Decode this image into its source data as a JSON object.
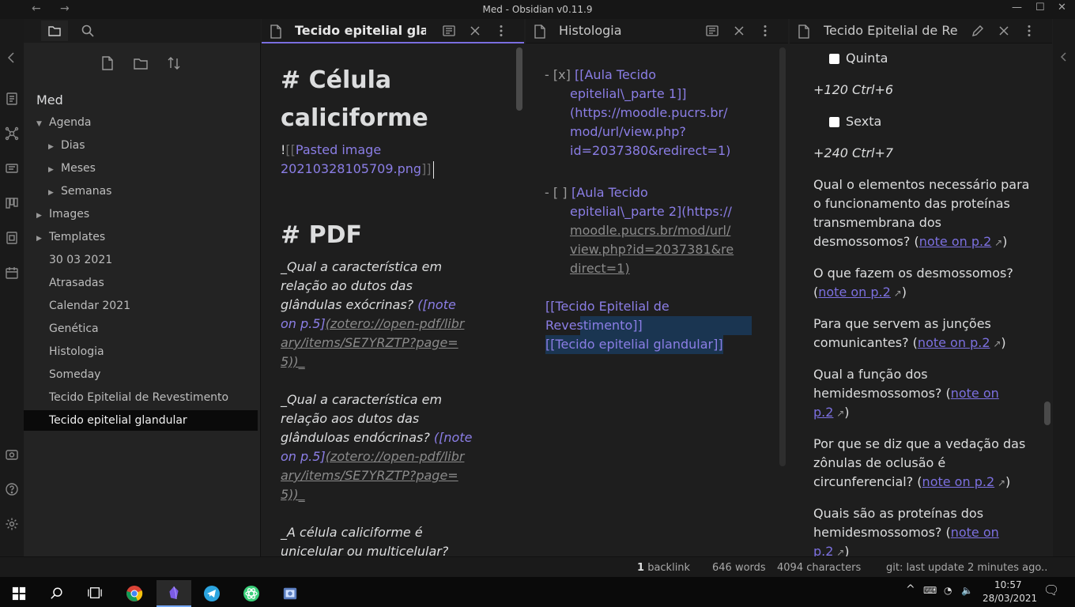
{
  "window": {
    "title": "Med - Obsidian v0.11.9"
  },
  "icons": {
    "back": "back-arrow-icon",
    "forward": "forward-arrow-icon",
    "minimize": "minimize-icon",
    "maximize": "maximize-icon",
    "close": "close-icon"
  },
  "sidebar": {
    "vault_name": "Med",
    "items": [
      {
        "label": "Agenda",
        "expanded": true,
        "level": 0,
        "folder": true
      },
      {
        "label": "Dias",
        "expanded": false,
        "level": 1,
        "folder": true
      },
      {
        "label": "Meses",
        "expanded": false,
        "level": 1,
        "folder": true
      },
      {
        "label": "Semanas",
        "expanded": false,
        "level": 1,
        "folder": true
      },
      {
        "label": "Images",
        "expanded": false,
        "level": 0,
        "folder": true
      },
      {
        "label": "Templates",
        "expanded": false,
        "level": 0,
        "folder": true
      },
      {
        "label": "30 03 2021",
        "level": 0,
        "folder": false
      },
      {
        "label": "Atrasadas",
        "level": 0,
        "folder": false
      },
      {
        "label": "Calendar 2021",
        "level": 0,
        "folder": false
      },
      {
        "label": "Genética",
        "level": 0,
        "folder": false
      },
      {
        "label": "Histologia",
        "level": 0,
        "folder": false
      },
      {
        "label": "Someday",
        "level": 0,
        "folder": false
      },
      {
        "label": "Tecido Epitelial de Revestimento",
        "level": 0,
        "folder": false
      },
      {
        "label": "Tecido epitelial glandular",
        "level": 0,
        "folder": false,
        "selected": true
      }
    ]
  },
  "pane1": {
    "tab_title": "Tecido epitelial glandular",
    "h1a_line1": "# Célula",
    "h1a_line2": "caliciforme",
    "embed_bang": "!",
    "embed_open": "[[",
    "embed_line1": "Pasted image",
    "embed_line2": "20210328105709.png",
    "embed_close": "]]",
    "h1b": "# PDF",
    "q1": [
      {
        "a": "_Qual a característica em",
        "b": ""
      },
      {
        "a": "relação ao dutos das",
        "b": ""
      },
      {
        "a": "glândulas exócrinas? ",
        "b": "([note"
      },
      {
        "a": "on p.5]",
        "b": "(zotero://open-pdf/libr"
      },
      {
        "a": "",
        "b": "ary/items/SE7YRZTP?page="
      },
      {
        "a": "5))_",
        "b": ""
      }
    ],
    "q2": [
      {
        "a": "_Qual a característica em",
        "b": ""
      },
      {
        "a": "relação aos dutos das",
        "b": ""
      },
      {
        "a": "glânduloas endócrinas? ",
        "b": "([note"
      },
      {
        "a": "on p.5]",
        "b": "(zotero://open-pdf/libr"
      },
      {
        "a": "",
        "b": "ary/items/SE7YRZTP?page="
      },
      {
        "a": "5))_",
        "b": ""
      }
    ],
    "q3": [
      "_A célula caliciforme é",
      "unicelular ou multicelular?"
    ]
  },
  "pane2": {
    "tab_title": "Histologia",
    "task1": {
      "prefix": "- [x] ",
      "link_lines": [
        "[[Aula Tecido",
        "epitelial\\_parte 1]]",
        "(https://moodle.pucrs.br/",
        "mod/url/view.php?",
        "id=2037380&redirect=1)"
      ]
    },
    "task2": {
      "prefix": "- [ ] ",
      "lines": [
        "[Aula Tecido",
        "epitelial\\_parte 2](https://",
        "moodle.pucrs.br/mod/url/",
        "view.php?id=2037381&re",
        "direct=1)"
      ]
    },
    "links": [
      "[[Tecido Epitelial de",
      "Revestimento]]",
      "[[Tecido epitelial glandular]]"
    ]
  },
  "pane3": {
    "tab_title": "Tecido Epitelial de Revestimento",
    "items": [
      {
        "checkbox": "Quinta"
      },
      {
        "italic": "+120 Ctrl+6"
      },
      {
        "checkbox": "Sexta"
      },
      {
        "italic": "+240 Ctrl+7"
      }
    ],
    "paragraphs": [
      {
        "lines": [
          "Qual o elementos necessário para",
          "o funcionamento das proteínas",
          "transmembrana dos",
          "desmossomos? ("
        ],
        "link": "note on p.2",
        "close": ")"
      },
      {
        "lines": [
          "O que fazem os desmossomos?",
          "("
        ],
        "link": "note on p.2",
        "close": ")"
      },
      {
        "lines": [
          "Para que servem as junções",
          "comunicantes? ("
        ],
        "link": "note on p.2",
        "close": ")"
      },
      {
        "lines": [
          "Qual a função dos",
          "hemidesmossomos? ("
        ],
        "link": "note on",
        "link2": "p.2",
        "close": ")"
      },
      {
        "lines": [
          "Por que se diz que a vedação das",
          "zônulas de oclusão é",
          "circunferencial? ("
        ],
        "link": "note on p.2",
        "close": ")"
      },
      {
        "lines": [
          "Quais são as proteínas dos",
          "hemidesmossomos? ("
        ],
        "link": "note on",
        "link2": "p.2",
        "close": ")"
      }
    ]
  },
  "status": {
    "backlinks_num": "1",
    "backlinks_label": "backlink",
    "words": "646 words",
    "chars": "4094 characters",
    "git": "git: last update 2 minutes ago.."
  },
  "taskbar": {
    "time": "10:57",
    "date": "28/03/2021"
  },
  "colors": {
    "accent": "#8b7ee6",
    "selection": "#0a0a0a",
    "highlight": "#1a3551"
  }
}
